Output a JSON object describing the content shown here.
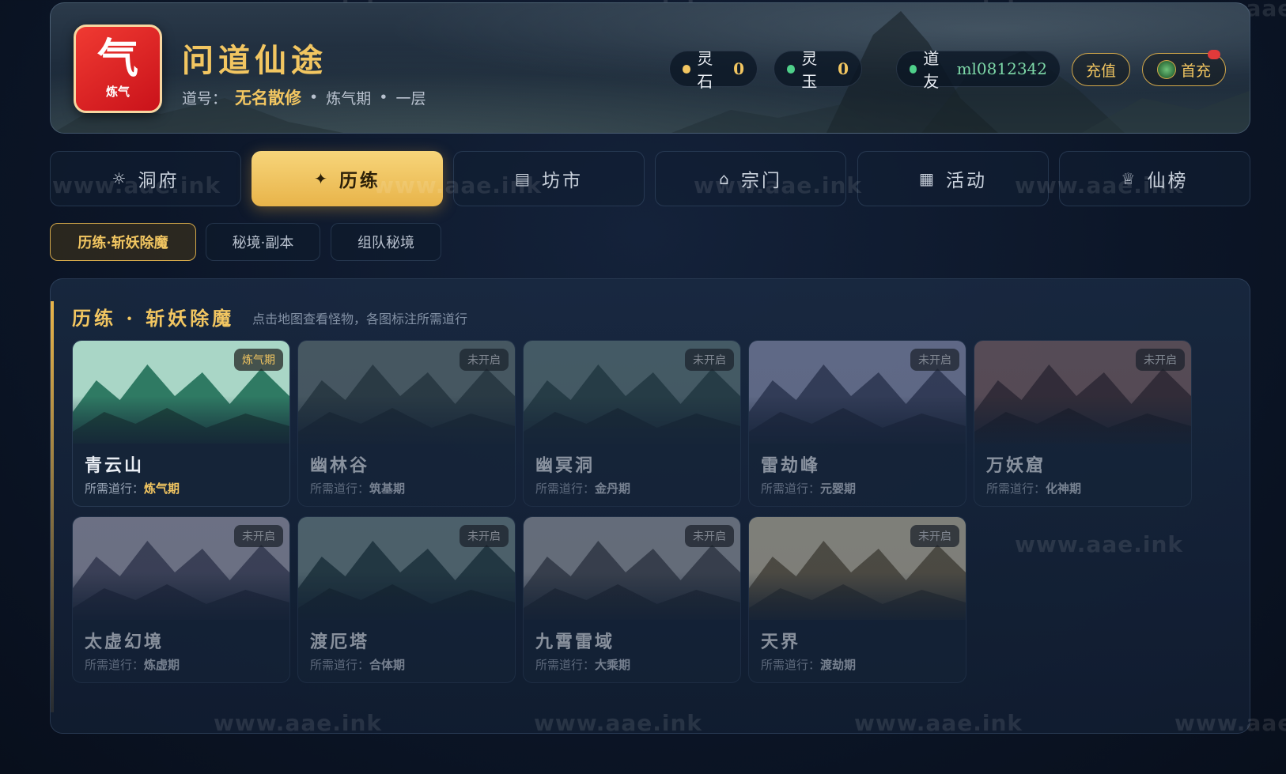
{
  "watermark": "www.aae.ink",
  "header": {
    "logo_main": "气",
    "logo_sub": "炼气",
    "title": "问道仙途",
    "dao_label": "道号：",
    "dao_name": "无名散修",
    "realm": "炼气期",
    "layer": "一层",
    "sep": "•"
  },
  "resources": {
    "lingshi_label": "灵石",
    "lingshi_value": "0",
    "lingyu_label": "灵玉",
    "lingyu_value": "0",
    "friend_label": "道友",
    "friend_id": "ml0812342",
    "recharge_label": "充值",
    "first_recharge_label": "首充"
  },
  "nav": {
    "tabs": [
      {
        "label": "洞府",
        "icon": "☼"
      },
      {
        "label": "历练",
        "icon": "✦"
      },
      {
        "label": "坊市",
        "icon": "▤"
      },
      {
        "label": "宗门",
        "icon": "⌂"
      },
      {
        "label": "活动",
        "icon": "▦"
      },
      {
        "label": "仙榜",
        "icon": "♕"
      }
    ],
    "active_index": 1
  },
  "subtabs": [
    "历练·斩妖除魔",
    "秘境·副本",
    "组队秘境"
  ],
  "panel": {
    "title": "历练 · 斩妖除魔",
    "hint": "点击地图查看怪物，各图标注所需道行",
    "req_label": "所需道行："
  },
  "maps": [
    {
      "name": "青云山",
      "req": "炼气期",
      "tag": "炼气期",
      "open": true
    },
    {
      "name": "幽林谷",
      "req": "筑基期",
      "tag": "未开启",
      "open": false
    },
    {
      "name": "幽冥洞",
      "req": "金丹期",
      "tag": "未开启",
      "open": false
    },
    {
      "name": "雷劫峰",
      "req": "元婴期",
      "tag": "未开启",
      "open": false
    },
    {
      "name": "万妖窟",
      "req": "化神期",
      "tag": "未开启",
      "open": false
    },
    {
      "name": "太虚幻境",
      "req": "炼虚期",
      "tag": "未开启",
      "open": false
    },
    {
      "name": "渡厄塔",
      "req": "合体期",
      "tag": "未开启",
      "open": false
    },
    {
      "name": "九霄雷域",
      "req": "大乘期",
      "tag": "未开启",
      "open": false
    },
    {
      "name": "天界",
      "req": "渡劫期",
      "tag": "未开启",
      "open": false
    }
  ],
  "colors": {
    "gold": "#f2c661",
    "lingshi_dot": "#f2c661",
    "lingyu_dot": "#4fd08a",
    "friend_dot": "#4fd08a"
  }
}
